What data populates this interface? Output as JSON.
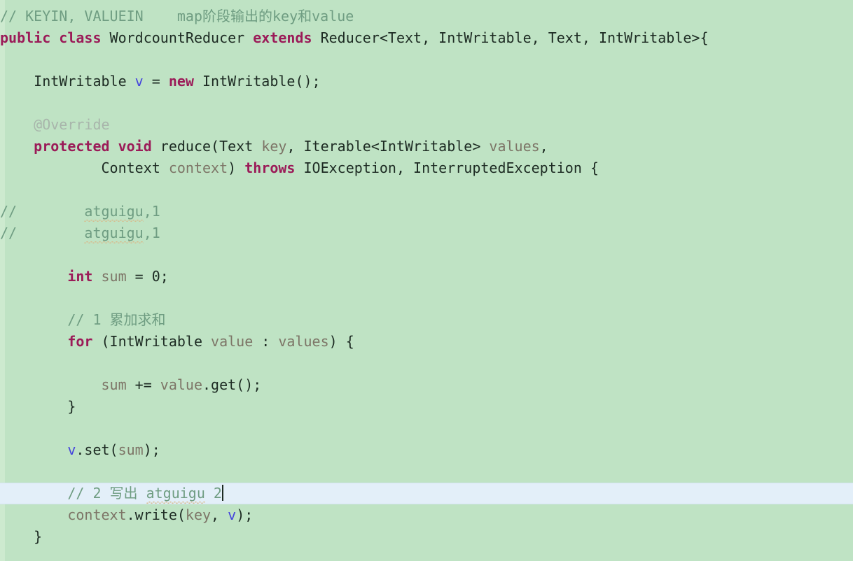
{
  "editor": {
    "language": "java",
    "file_type": "Java source",
    "colors": {
      "background": "#bfe3c4",
      "gutter": "#cdeacf",
      "current_line_highlight": "#e3eff9",
      "keyword": "#9b1b58",
      "comment": "#6f9d82",
      "annotation": "#a8b5ab",
      "identifier": "#1d2b23",
      "local_variable": "#7d7567",
      "field_variable": "#4444dd",
      "spellcheck_squiggle": "#d9b98a"
    },
    "caret": {
      "line_index": 17,
      "visible": true
    },
    "current_line_index": 17
  },
  "code": {
    "lines": [
      {
        "indent": "",
        "tokens": [
          {
            "t": "// KEYIN, VALUEIN    map阶段输出的key和value",
            "c": "cmt"
          }
        ]
      },
      {
        "indent": "",
        "tokens": [
          {
            "t": "public",
            "c": "kw"
          },
          {
            "t": " ",
            "c": "punct"
          },
          {
            "t": "class",
            "c": "kw"
          },
          {
            "t": " WordcountReducer ",
            "c": "ident"
          },
          {
            "t": "extends",
            "c": "kw"
          },
          {
            "t": " Reducer<Text, IntWritable, Text, IntWritable>{",
            "c": "ident"
          }
        ]
      },
      {
        "indent": "",
        "tokens": []
      },
      {
        "indent": "    ",
        "tokens": [
          {
            "t": "IntWritable ",
            "c": "ident"
          },
          {
            "t": "v",
            "c": "field"
          },
          {
            "t": " = ",
            "c": "punct"
          },
          {
            "t": "new",
            "c": "kw"
          },
          {
            "t": " IntWritable();",
            "c": "ident"
          }
        ]
      },
      {
        "indent": "",
        "tokens": []
      },
      {
        "indent": "    ",
        "tokens": [
          {
            "t": "@Override",
            "c": "anno"
          }
        ]
      },
      {
        "indent": "    ",
        "tokens": [
          {
            "t": "protected",
            "c": "kw"
          },
          {
            "t": " ",
            "c": "punct"
          },
          {
            "t": "void",
            "c": "kw"
          },
          {
            "t": " reduce(Text ",
            "c": "ident"
          },
          {
            "t": "key",
            "c": "local"
          },
          {
            "t": ", Iterable<IntWritable> ",
            "c": "ident"
          },
          {
            "t": "values",
            "c": "local"
          },
          {
            "t": ",",
            "c": "punct"
          }
        ]
      },
      {
        "indent": "            ",
        "tokens": [
          {
            "t": "Context ",
            "c": "ident"
          },
          {
            "t": "context",
            "c": "local"
          },
          {
            "t": ") ",
            "c": "punct"
          },
          {
            "t": "throws",
            "c": "kw"
          },
          {
            "t": " IOException, InterruptedException {",
            "c": "ident"
          }
        ]
      },
      {
        "indent": "",
        "tokens": []
      },
      {
        "indent": "",
        "tokens": [
          {
            "t": "//",
            "c": "cmt"
          },
          {
            "t": "        ",
            "c": "cmt"
          },
          {
            "t": "atguigu",
            "c": "cmt",
            "squiggle": true
          },
          {
            "t": ",1",
            "c": "cmt"
          }
        ]
      },
      {
        "indent": "",
        "tokens": [
          {
            "t": "//",
            "c": "cmt"
          },
          {
            "t": "        ",
            "c": "cmt"
          },
          {
            "t": "atguigu",
            "c": "cmt",
            "squiggle": true
          },
          {
            "t": ",1",
            "c": "cmt"
          }
        ]
      },
      {
        "indent": "",
        "tokens": []
      },
      {
        "indent": "        ",
        "tokens": [
          {
            "t": "int",
            "c": "kw"
          },
          {
            "t": " ",
            "c": "punct"
          },
          {
            "t": "sum",
            "c": "local"
          },
          {
            "t": " = ",
            "c": "punct"
          },
          {
            "t": "0",
            "c": "num"
          },
          {
            "t": ";",
            "c": "punct"
          }
        ]
      },
      {
        "indent": "",
        "tokens": []
      },
      {
        "indent": "        ",
        "tokens": [
          {
            "t": "// 1 累加求和",
            "c": "cmt"
          }
        ]
      },
      {
        "indent": "        ",
        "tokens": [
          {
            "t": "for",
            "c": "kw"
          },
          {
            "t": " (IntWritable ",
            "c": "ident"
          },
          {
            "t": "value",
            "c": "local"
          },
          {
            "t": " : ",
            "c": "punct"
          },
          {
            "t": "values",
            "c": "local"
          },
          {
            "t": ") {",
            "c": "punct"
          }
        ]
      },
      {
        "indent": "",
        "tokens": []
      },
      {
        "indent": "            ",
        "tokens": [
          {
            "t": "sum",
            "c": "local"
          },
          {
            "t": " += ",
            "c": "punct"
          },
          {
            "t": "value",
            "c": "local"
          },
          {
            "t": ".get();",
            "c": "ident"
          }
        ]
      },
      {
        "indent": "        ",
        "tokens": [
          {
            "t": "}",
            "c": "punct"
          }
        ]
      },
      {
        "indent": "",
        "tokens": []
      },
      {
        "indent": "        ",
        "tokens": [
          {
            "t": "v",
            "c": "field"
          },
          {
            "t": ".set(",
            "c": "ident"
          },
          {
            "t": "sum",
            "c": "local"
          },
          {
            "t": ");",
            "c": "ident"
          }
        ]
      },
      {
        "indent": "",
        "tokens": []
      },
      {
        "indent": "        ",
        "tokens": [
          {
            "t": "// 2 写出 ",
            "c": "cmt"
          },
          {
            "t": "atguigu",
            "c": "cmt",
            "squiggle": true
          },
          {
            "t": " 2",
            "c": "cmt"
          },
          {
            "t": "",
            "c": "caret"
          }
        ]
      },
      {
        "indent": "        ",
        "tokens": [
          {
            "t": "context",
            "c": "local"
          },
          {
            "t": ".write(",
            "c": "ident"
          },
          {
            "t": "key",
            "c": "local"
          },
          {
            "t": ", ",
            "c": "punct"
          },
          {
            "t": "v",
            "c": "field"
          },
          {
            "t": ");",
            "c": "ident"
          }
        ]
      },
      {
        "indent": "    ",
        "tokens": [
          {
            "t": "}",
            "c": "punct"
          }
        ]
      }
    ]
  }
}
